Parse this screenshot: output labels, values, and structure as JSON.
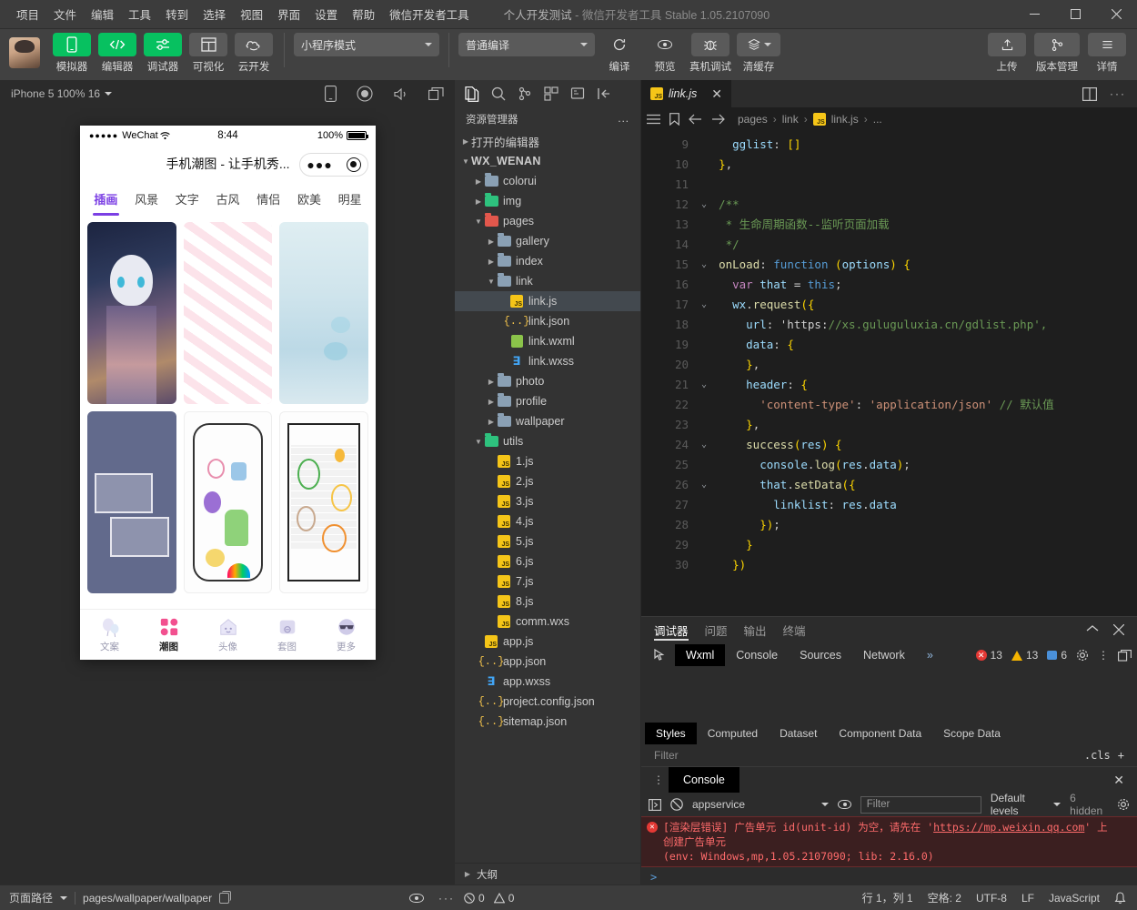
{
  "titlebar": {
    "menus": [
      "项目",
      "文件",
      "编辑",
      "工具",
      "转到",
      "选择",
      "视图",
      "界面",
      "设置",
      "帮助",
      "微信开发者工具"
    ],
    "project_name": "个人开发测试",
    "app_name": "微信开发者工具",
    "version": "Stable 1.05.2107090",
    "sep": "-"
  },
  "toolbar": {
    "buttons": [
      {
        "label": "模拟器",
        "icon": "phone-icon",
        "style": "green"
      },
      {
        "label": "编辑器",
        "icon": "code-icon",
        "style": "green"
      },
      {
        "label": "调试器",
        "icon": "sliders-icon",
        "style": "green"
      },
      {
        "label": "可视化",
        "icon": "layout-icon",
        "style": "grey"
      },
      {
        "label": "云开发",
        "icon": "cloud-icon",
        "style": "grey"
      }
    ],
    "mode_select": "小程序模式",
    "compile_select": "普通编译",
    "compile_label": "编译",
    "preview_label": "预览",
    "realdevice_label": "真机调试",
    "clearcache_label": "清缓存",
    "upload_label": "上传",
    "version_label": "版本管理",
    "detail_label": "详情"
  },
  "simulator": {
    "device": "iPhone 5 100% 16",
    "icons": [
      "device-rotate-icon",
      "record-icon",
      "volume-icon",
      "window-icon"
    ],
    "phone": {
      "carrier": "WeChat",
      "signal_dots": "●●●●●",
      "time": "8:44",
      "battery": "100%",
      "nav_title": "手机潮图 - 让手机秀...",
      "capsule_more": "●●●",
      "categories": [
        "插画",
        "风景",
        "文字",
        "古风",
        "情侣",
        "欧美",
        "明星"
      ],
      "active_category": "插画",
      "tabbar": [
        {
          "label": "文案",
          "icon": "balloon-icon",
          "active": false
        },
        {
          "label": "潮图",
          "icon": "grid-icon",
          "active": true
        },
        {
          "label": "头像",
          "icon": "house-face-icon",
          "active": false
        },
        {
          "label": "套图",
          "icon": "album-icon",
          "active": false
        },
        {
          "label": "更多",
          "icon": "sunglasses-icon",
          "active": false
        }
      ]
    }
  },
  "explorer": {
    "activity_icons": [
      "files-icon",
      "search-icon",
      "source-control-icon",
      "extensions-icon",
      "debug-icon",
      "collapse-icon"
    ],
    "header": "资源管理器",
    "header_menu": "...",
    "sections": [
      "打开的编辑器",
      "WX_WENAN"
    ],
    "tree": [
      {
        "label": "打开的编辑器",
        "depth": 0,
        "type": "section",
        "expanded": false
      },
      {
        "label": "WX_WENAN",
        "depth": 0,
        "type": "root",
        "expanded": true
      },
      {
        "label": "colorui",
        "depth": 1,
        "type": "folder",
        "expanded": false,
        "color": "blue"
      },
      {
        "label": "img",
        "depth": 1,
        "type": "folder",
        "expanded": false,
        "color": "green"
      },
      {
        "label": "pages",
        "depth": 1,
        "type": "folder",
        "expanded": true,
        "color": "red"
      },
      {
        "label": "gallery",
        "depth": 2,
        "type": "folder",
        "expanded": false,
        "color": "blue"
      },
      {
        "label": "index",
        "depth": 2,
        "type": "folder",
        "expanded": false,
        "color": "blue"
      },
      {
        "label": "link",
        "depth": 2,
        "type": "folder",
        "expanded": true,
        "color": "blue"
      },
      {
        "label": "link.js",
        "depth": 3,
        "type": "js",
        "selected": true
      },
      {
        "label": "link.json",
        "depth": 3,
        "type": "json"
      },
      {
        "label": "link.wxml",
        "depth": 3,
        "type": "wxml"
      },
      {
        "label": "link.wxss",
        "depth": 3,
        "type": "wxss"
      },
      {
        "label": "photo",
        "depth": 2,
        "type": "folder",
        "expanded": false,
        "color": "blue"
      },
      {
        "label": "profile",
        "depth": 2,
        "type": "folder",
        "expanded": false,
        "color": "blue"
      },
      {
        "label": "wallpaper",
        "depth": 2,
        "type": "folder",
        "expanded": false,
        "color": "blue"
      },
      {
        "label": "utils",
        "depth": 1,
        "type": "folder",
        "expanded": true,
        "color": "green"
      },
      {
        "label": "1.js",
        "depth": 2,
        "type": "js"
      },
      {
        "label": "2.js",
        "depth": 2,
        "type": "js"
      },
      {
        "label": "3.js",
        "depth": 2,
        "type": "js"
      },
      {
        "label": "4.js",
        "depth": 2,
        "type": "js"
      },
      {
        "label": "5.js",
        "depth": 2,
        "type": "js"
      },
      {
        "label": "6.js",
        "depth": 2,
        "type": "js"
      },
      {
        "label": "7.js",
        "depth": 2,
        "type": "js"
      },
      {
        "label": "8.js",
        "depth": 2,
        "type": "js"
      },
      {
        "label": "comm.wxs",
        "depth": 2,
        "type": "js"
      },
      {
        "label": "app.js",
        "depth": 1,
        "type": "js"
      },
      {
        "label": "app.json",
        "depth": 1,
        "type": "json"
      },
      {
        "label": "app.wxss",
        "depth": 1,
        "type": "wxss"
      },
      {
        "label": "project.config.json",
        "depth": 1,
        "type": "json"
      },
      {
        "label": "sitemap.json",
        "depth": 1,
        "type": "json"
      }
    ],
    "outline": "大纲"
  },
  "editor": {
    "tab": {
      "name": "link.js",
      "close": "✕"
    },
    "split_icon": "split-editor-icon",
    "more_icon": "more-icon",
    "breadcrumb": [
      "pages",
      "link",
      "link.js",
      "..."
    ],
    "first_line_number": 9,
    "lines": [
      {
        "n": 9,
        "fold": false,
        "text": "    gglist: []"
      },
      {
        "n": 10,
        "fold": false,
        "text": "  },"
      },
      {
        "n": 11,
        "fold": false,
        "text": ""
      },
      {
        "n": 12,
        "fold": true,
        "text": "  /**"
      },
      {
        "n": 13,
        "fold": false,
        "text": "   * 生命周期函数--监听页面加载"
      },
      {
        "n": 14,
        "fold": false,
        "text": "   */"
      },
      {
        "n": 15,
        "fold": true,
        "text": "  onLoad: function (options) {"
      },
      {
        "n": 16,
        "fold": false,
        "text": "    var that = this;"
      },
      {
        "n": 17,
        "fold": true,
        "text": "    wx.request({"
      },
      {
        "n": 18,
        "fold": false,
        "text": "      url: 'https://xs.guluguluxia.cn/gdlist.php',"
      },
      {
        "n": 19,
        "fold": false,
        "text": "      data: {"
      },
      {
        "n": 20,
        "fold": false,
        "text": "      },"
      },
      {
        "n": 21,
        "fold": true,
        "text": "      header: {"
      },
      {
        "n": 22,
        "fold": false,
        "text": "        'content-type': 'application/json' // 默认值"
      },
      {
        "n": 23,
        "fold": false,
        "text": "      },"
      },
      {
        "n": 24,
        "fold": true,
        "text": "      success(res) {"
      },
      {
        "n": 25,
        "fold": false,
        "text": "        console.log(res.data);"
      },
      {
        "n": 26,
        "fold": true,
        "text": "        that.setData({"
      },
      {
        "n": 27,
        "fold": false,
        "text": "          linklist: res.data"
      },
      {
        "n": 28,
        "fold": false,
        "text": "        });"
      },
      {
        "n": 29,
        "fold": false,
        "text": "      }"
      },
      {
        "n": 30,
        "fold": false,
        "text": "    })"
      }
    ]
  },
  "debugger": {
    "panel_tabs": [
      "调试器",
      "问题",
      "输出",
      "终端"
    ],
    "panel_active": "调试器",
    "collapse_icon": "chevron-up-icon",
    "close_icon": "close-icon",
    "inspect_icon": "inspect-element-icon",
    "devtools_tabs": [
      "Wxml",
      "Console",
      "Sources",
      "Network"
    ],
    "devtools_active": "Wxml",
    "more_tabs": "»",
    "counts": {
      "errors": "13",
      "warnings": "13",
      "info": "6"
    },
    "settings_icon": "gear-icon",
    "kebab_icon": "kebab-icon",
    "dock_icon": "dock-icon",
    "styles_tabs": [
      "Styles",
      "Computed",
      "Dataset",
      "Component Data",
      "Scope Data"
    ],
    "styles_active": "Styles",
    "filter_placeholder": "Filter",
    "cls_label": ".cls",
    "add_label": "+"
  },
  "console": {
    "kebab_icon": "kebab-icon",
    "tab_label": "Console",
    "close_icon": "close-icon",
    "toolbar_icons": [
      "sidebar-toggle-icon",
      "clear-console-icon",
      "eye-icon"
    ],
    "context": "appservice",
    "filter_placeholder": "Filter",
    "levels": "Default levels",
    "hidden": "6 hidden",
    "settings_icon": "gear-icon",
    "message": {
      "line1_pre": "[渲染层错误] 广告单元 id(unit-id) 为空，请先在 '",
      "link": "https://mp.weixin.qq.com",
      "line1_post": "' 上",
      "line2": "创建广告单元",
      "line3": "(env: Windows,mp,1.05.2107090; lib: 2.16.0)"
    },
    "prompt": ">"
  },
  "statusbar": {
    "page_path_label": "页面路径",
    "page_path": "pages/wallpaper/wallpaper",
    "copy_icon": "copy-icon",
    "eye_icon": "eye-icon",
    "more_icon": "more-icon",
    "errors": "0",
    "warnings": "0",
    "cursor": "行 1，列 1",
    "spaces": "空格: 2",
    "encoding": "UTF-8",
    "eol": "LF",
    "language": "JavaScript",
    "bell_icon": "bell-icon"
  }
}
